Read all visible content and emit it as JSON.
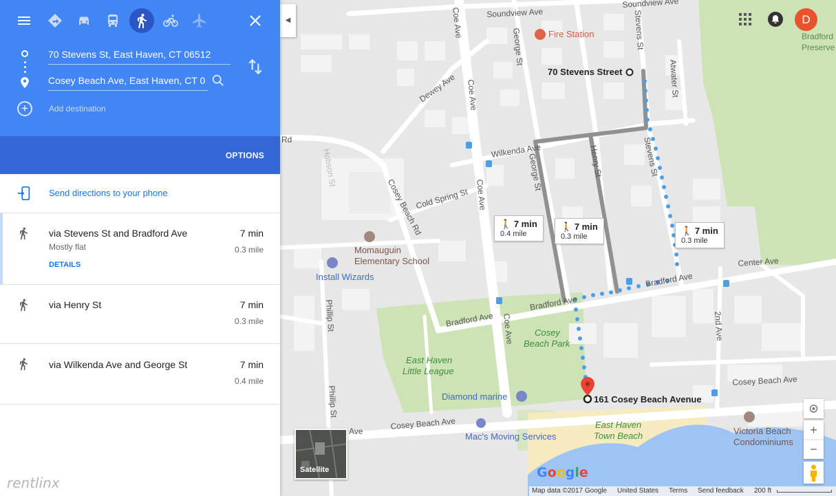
{
  "panel": {
    "origin": "70 Stevens St, East Haven, CT 06512",
    "destination": "Cosey Beach Ave, East Haven, CT 0",
    "add_destination": "Add destination",
    "options": "OPTIONS",
    "send_directions": "Send directions to your phone",
    "routes": [
      {
        "title": "via Stevens St and Bradford Ave",
        "time": "7 min",
        "distance": "0.3 mile",
        "subtitle": "Mostly flat",
        "details": "DETAILS"
      },
      {
        "title": "via Henry St",
        "time": "7 min",
        "distance": "0.3 mile"
      },
      {
        "title": "via Wilkenda Ave and George St",
        "time": "7 min",
        "distance": "0.4 mile"
      }
    ],
    "watermark": "rentlinx"
  },
  "colors": {
    "panel_blue": "#4285f4",
    "options_blue": "#3367d6",
    "route_blue": "#4a9fe8",
    "link_blue": "#1a73e8"
  },
  "map": {
    "streets": {
      "soundview_ave": "Soundview Ave",
      "soundview_ave_2": "Soundview Ave",
      "coe_ave_1": "Coe Ave",
      "coe_ave_2": "Coe Ave",
      "coe_ave_3": "Coe Ave",
      "coe_ave_4": "Coe Ave",
      "george_st_1": "George St",
      "george_st_2": "George St",
      "stevens_st_1": "Stevens St",
      "stevens_st_2": "Stevens St",
      "atwater_st": "Atwater St",
      "dewey_ave": "Dewey Ave",
      "wilkenda_ave": "Wilkenda Ave",
      "henry_st": "Henry St",
      "rd_left": "Rd",
      "hobson": "Hobson St",
      "cold_spring_st": "Cold Spring St",
      "cosey_beach_rd": "Cosey Beach Rd",
      "bradford_ave_1": "Bradford Ave",
      "bradford_ave_2": "Bradford Ave",
      "bradford_ave_3": "Bradford Ave",
      "center_ave": "Center Ave",
      "phillip_st_1": "Phillip St",
      "phillip_st_2": "Phillip St",
      "second_ave": "2nd Ave",
      "cosey_beach_ave_1": "Cosey Beach Ave",
      "cosey_beach_ave_2": "Cosey Beach Ave",
      "ave_left": "Ave"
    },
    "pois": {
      "fire_station": "Fire Station",
      "bradford_preserve_1": "Bradford",
      "bradford_preserve_2": "Preserve",
      "school_1": "Momauguin",
      "school_2": "Elementary School",
      "install_wizards": "Install Wizards",
      "park_1": "Cosey",
      "park_2": "Beach Park",
      "little_league_1": "East Haven",
      "little_league_2": "Little League",
      "diamond_marine": "Diamond marine",
      "macs_moving": "Mac's Moving Services",
      "town_beach_1": "East Haven",
      "town_beach_2": "Town Beach",
      "victoria_1": "Victoria Beach",
      "victoria_2": "Condominiums"
    },
    "origin_label": "70 Stevens Street",
    "destination_label": "161 Cosey Beach Avenue",
    "callouts": [
      {
        "time": "7 min",
        "distance": "0.4 mile"
      },
      {
        "time": "7 min",
        "distance": "0.3 mile"
      },
      {
        "time": "7 min",
        "distance": "0.3 mile"
      }
    ],
    "avatar_letter": "D",
    "satellite": "Satellite",
    "google": "Google",
    "footer": {
      "map_data": "Map data ©2017 Google",
      "country": "United States",
      "terms": "Terms",
      "feedback": "Send feedback",
      "scale": "200 ft"
    }
  }
}
